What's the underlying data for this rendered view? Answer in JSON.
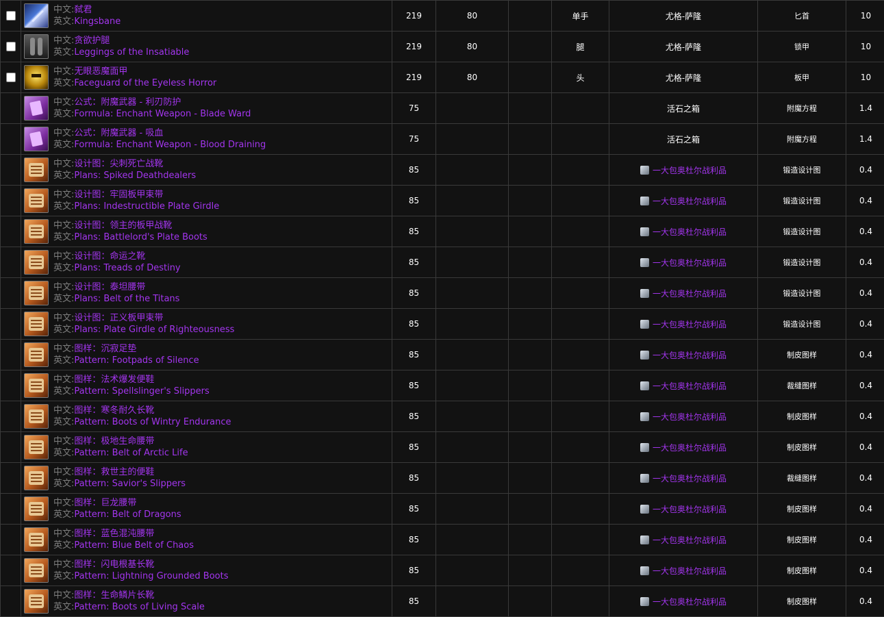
{
  "labels": {
    "zh": "中文:",
    "en": "英文:"
  },
  "rows": [
    {
      "checkbox": true,
      "icon": "sword-icon",
      "zh": "弑君",
      "en": "Kingsbane",
      "level": "219",
      "req": "80",
      "empty": "",
      "slot": "单手",
      "source": "尤格-萨隆",
      "source_link": false,
      "type": "匕首",
      "rate": "10"
    },
    {
      "checkbox": true,
      "icon": "leggings-icon",
      "zh": "贪欲护腿",
      "en": "Leggings of the Insatiable",
      "level": "219",
      "req": "80",
      "empty": "",
      "slot": "腿",
      "source": "尤格-萨隆",
      "source_link": false,
      "type": "锁甲",
      "rate": "10"
    },
    {
      "checkbox": true,
      "icon": "helm-icon",
      "zh": "无眼恶魔面甲",
      "en": "Faceguard of the Eyeless Horror",
      "level": "219",
      "req": "80",
      "empty": "",
      "slot": "头",
      "source": "尤格-萨隆",
      "source_link": false,
      "type": "板甲",
      "rate": "10"
    },
    {
      "checkbox": false,
      "icon": "formula-icon",
      "zh": "公式：附魔武器 - 利刃防护",
      "en": "Formula: Enchant Weapon - Blade Ward",
      "level": "75",
      "req": "",
      "empty": "",
      "slot": "",
      "source": "活石之箱",
      "source_link": false,
      "type": "附魔方程",
      "rate": "1.4"
    },
    {
      "checkbox": false,
      "icon": "formula-icon",
      "zh": "公式：附魔武器 - 吸血",
      "en": "Formula: Enchant Weapon - Blood Draining",
      "level": "75",
      "req": "",
      "empty": "",
      "slot": "",
      "source": "活石之箱",
      "source_link": false,
      "type": "附魔方程",
      "rate": "1.4"
    },
    {
      "checkbox": false,
      "icon": "plans-icon",
      "zh": "设计图：尖刺死亡战靴",
      "en": "Plans: Spiked Deathdealers",
      "level": "85",
      "req": "",
      "empty": "",
      "slot": "",
      "source": "一大包奥杜尔战利品",
      "source_link": true,
      "type": "锻造设计图",
      "rate": "0.4"
    },
    {
      "checkbox": false,
      "icon": "plans-icon",
      "zh": "设计图：牢固板甲束带",
      "en": "Plans: Indestructible Plate Girdle",
      "level": "85",
      "req": "",
      "empty": "",
      "slot": "",
      "source": "一大包奥杜尔战利品",
      "source_link": true,
      "type": "锻造设计图",
      "rate": "0.4"
    },
    {
      "checkbox": false,
      "icon": "plans-icon",
      "zh": "设计图：领主的板甲战靴",
      "en": "Plans: Battlelord's Plate Boots",
      "level": "85",
      "req": "",
      "empty": "",
      "slot": "",
      "source": "一大包奥杜尔战利品",
      "source_link": true,
      "type": "锻造设计图",
      "rate": "0.4"
    },
    {
      "checkbox": false,
      "icon": "plans-icon",
      "zh": "设计图：命运之靴",
      "en": "Plans: Treads of Destiny",
      "level": "85",
      "req": "",
      "empty": "",
      "slot": "",
      "source": "一大包奥杜尔战利品",
      "source_link": true,
      "type": "锻造设计图",
      "rate": "0.4"
    },
    {
      "checkbox": false,
      "icon": "plans-icon",
      "zh": "设计图：泰坦腰带",
      "en": "Plans: Belt of the Titans",
      "level": "85",
      "req": "",
      "empty": "",
      "slot": "",
      "source": "一大包奥杜尔战利品",
      "source_link": true,
      "type": "锻造设计图",
      "rate": "0.4"
    },
    {
      "checkbox": false,
      "icon": "plans-icon",
      "zh": "设计图：正义板甲束带",
      "en": "Plans: Plate Girdle of Righteousness",
      "level": "85",
      "req": "",
      "empty": "",
      "slot": "",
      "source": "一大包奥杜尔战利品",
      "source_link": true,
      "type": "锻造设计图",
      "rate": "0.4"
    },
    {
      "checkbox": false,
      "icon": "plans-icon",
      "zh": "图样：沉寂足垫",
      "en": "Pattern: Footpads of Silence",
      "level": "85",
      "req": "",
      "empty": "",
      "slot": "",
      "source": "一大包奥杜尔战利品",
      "source_link": true,
      "type": "制皮图样",
      "rate": "0.4"
    },
    {
      "checkbox": false,
      "icon": "plans-icon",
      "zh": "图样：法术爆发便鞋",
      "en": "Pattern: Spellslinger's Slippers",
      "level": "85",
      "req": "",
      "empty": "",
      "slot": "",
      "source": "一大包奥杜尔战利品",
      "source_link": true,
      "type": "裁缝图样",
      "rate": "0.4"
    },
    {
      "checkbox": false,
      "icon": "plans-icon",
      "zh": "图样：寒冬耐久长靴",
      "en": "Pattern: Boots of Wintry Endurance",
      "level": "85",
      "req": "",
      "empty": "",
      "slot": "",
      "source": "一大包奥杜尔战利品",
      "source_link": true,
      "type": "制皮图样",
      "rate": "0.4"
    },
    {
      "checkbox": false,
      "icon": "plans-icon",
      "zh": "图样：极地生命腰带",
      "en": "Pattern: Belt of Arctic Life",
      "level": "85",
      "req": "",
      "empty": "",
      "slot": "",
      "source": "一大包奥杜尔战利品",
      "source_link": true,
      "type": "制皮图样",
      "rate": "0.4"
    },
    {
      "checkbox": false,
      "icon": "plans-icon",
      "zh": "图样：救世主的便鞋",
      "en": "Pattern: Savior's Slippers",
      "level": "85",
      "req": "",
      "empty": "",
      "slot": "",
      "source": "一大包奥杜尔战利品",
      "source_link": true,
      "type": "裁缝图样",
      "rate": "0.4"
    },
    {
      "checkbox": false,
      "icon": "plans-icon",
      "zh": "图样：巨龙腰带",
      "en": "Pattern: Belt of Dragons",
      "level": "85",
      "req": "",
      "empty": "",
      "slot": "",
      "source": "一大包奥杜尔战利品",
      "source_link": true,
      "type": "制皮图样",
      "rate": "0.4"
    },
    {
      "checkbox": false,
      "icon": "plans-icon",
      "zh": "图样：蓝色混沌腰带",
      "en": "Pattern: Blue Belt of Chaos",
      "level": "85",
      "req": "",
      "empty": "",
      "slot": "",
      "source": "一大包奥杜尔战利品",
      "source_link": true,
      "type": "制皮图样",
      "rate": "0.4"
    },
    {
      "checkbox": false,
      "icon": "plans-icon",
      "zh": "图样：闪电根基长靴",
      "en": "Pattern: Lightning Grounded Boots",
      "level": "85",
      "req": "",
      "empty": "",
      "slot": "",
      "source": "一大包奥杜尔战利品",
      "source_link": true,
      "type": "制皮图样",
      "rate": "0.4"
    },
    {
      "checkbox": false,
      "icon": "plans-icon",
      "zh": "图样：生命鳞片长靴",
      "en": "Pattern: Boots of Living Scale",
      "level": "85",
      "req": "",
      "empty": "",
      "slot": "",
      "source": "一大包奥杜尔战利品",
      "source_link": true,
      "type": "制皮图样",
      "rate": "0.4"
    }
  ],
  "colors": {
    "epic": "#a335ee",
    "label": "#7d7d7d",
    "text": "#ffffff",
    "bg": "#121212",
    "border": "#3a3a3a"
  }
}
